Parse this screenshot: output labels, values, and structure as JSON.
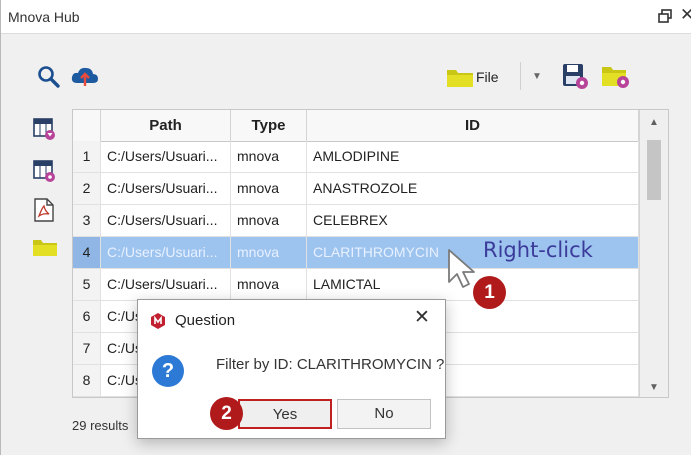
{
  "window": {
    "title": "Mnova Hub"
  },
  "toolbar": {
    "file_label": "File"
  },
  "table": {
    "columns": [
      "Path",
      "Type",
      "ID"
    ],
    "rows": [
      {
        "num": "1",
        "path": "C:/Users/Usuari...",
        "type": "mnova",
        "id": "AMLODIPINE"
      },
      {
        "num": "2",
        "path": "C:/Users/Usuari...",
        "type": "mnova",
        "id": "ANASTROZOLE"
      },
      {
        "num": "3",
        "path": "C:/Users/Usuari...",
        "type": "mnova",
        "id": "CELEBREX"
      },
      {
        "num": "4",
        "path": "C:/Users/Usuari...",
        "type": "mnova",
        "id": "CLARITHROMYCIN"
      },
      {
        "num": "5",
        "path": "C:/Users/Usuari...",
        "type": "mnova",
        "id": "LAMICTAL"
      },
      {
        "num": "6",
        "path": "C:/Us",
        "type": "",
        "id": ""
      },
      {
        "num": "7",
        "path": "C:/Us",
        "type": "",
        "id": ""
      },
      {
        "num": "8",
        "path": "C:/Us",
        "type": "",
        "id": ""
      }
    ],
    "selected_row": "4"
  },
  "status": {
    "results": "29 results"
  },
  "annotation": {
    "text": "Right-click",
    "badge1": "1",
    "badge2": "2"
  },
  "dialog": {
    "title": "Question",
    "message": "Filter by ID: CLARITHROMYCIN ?",
    "yes_label": "Yes",
    "no_label": "No",
    "icon": "question-icon"
  },
  "colors": {
    "selection": "#9dc3ef",
    "badge": "#b01a1a",
    "annotation": "#3b3b9a",
    "yes_highlight": "#c02020"
  }
}
